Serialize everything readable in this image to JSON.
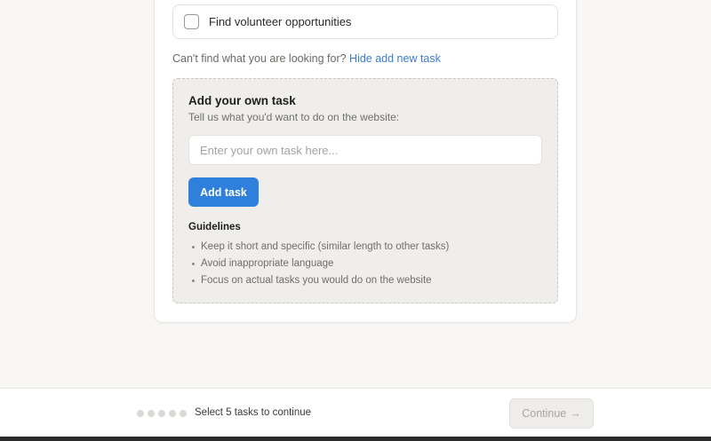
{
  "task_list": {
    "items": [
      {
        "label": "Find volunteer opportunities",
        "checked": false
      }
    ]
  },
  "cant_find": {
    "text": "Can't find what you are looking for?",
    "link": "Hide add new task"
  },
  "own_task": {
    "title": "Add your own task",
    "subtitle": "Tell us what you'd want to do on the website:",
    "input_value": "",
    "input_placeholder": "Enter your own task here...",
    "add_button": "Add task",
    "guidelines_title": "Guidelines",
    "guidelines": [
      "Keep it short and specific (similar length to other tasks)",
      "Avoid inappropriate language",
      "Focus on actual tasks you would do on the website"
    ]
  },
  "footer": {
    "progress": {
      "selected": 0,
      "total": 5
    },
    "status": "Select 5 tasks to continue",
    "continue_label": "Continue",
    "continue_icon": "arrow-right-icon",
    "continue_disabled": true
  },
  "colors": {
    "accent": "#2f80dd",
    "link": "#3a7bd5",
    "page_bg": "#f8f7f5",
    "panel_bg": "#efeeeb"
  }
}
